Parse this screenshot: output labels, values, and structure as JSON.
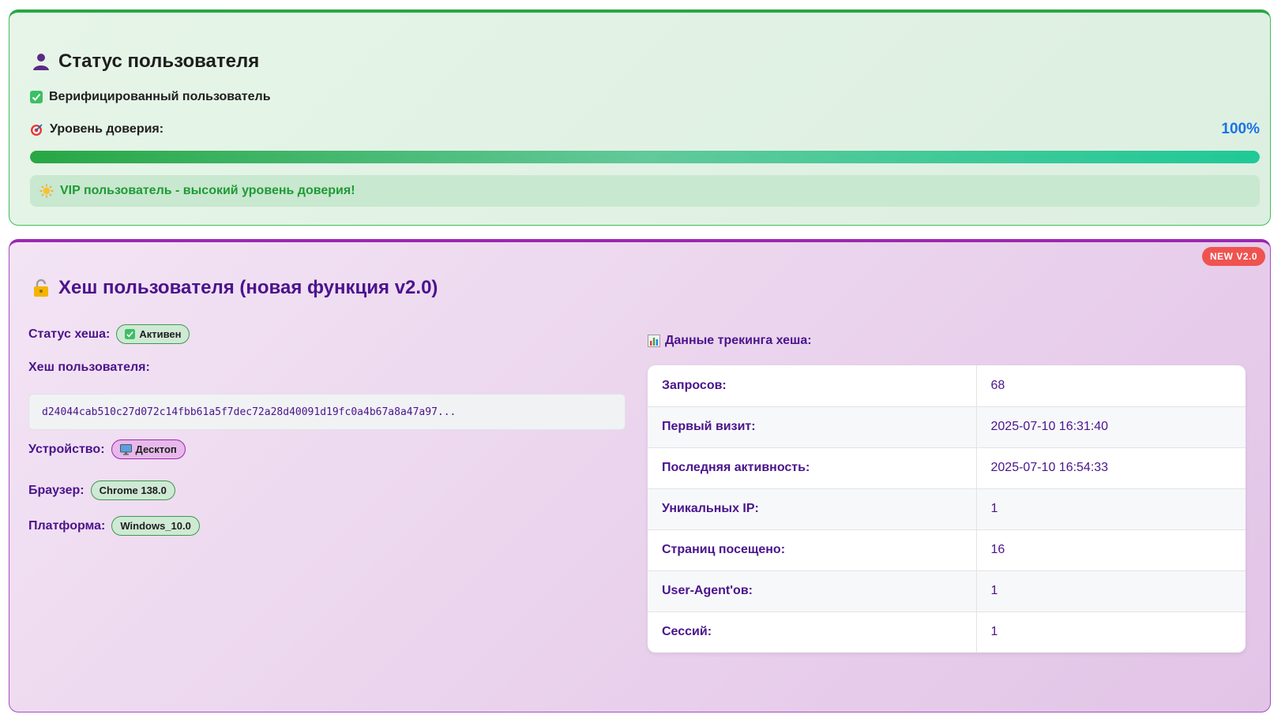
{
  "status": {
    "title": "Статус пользователя",
    "verified_label": "Верифицированный пользователь",
    "trust_label": "Уровень доверия:",
    "trust_value": "100%",
    "trust_fraction": 1.0,
    "vip_text": "VIP пользователь - высокий уровень доверия!",
    "icons": {
      "title": "user-icon",
      "verified": "check-icon",
      "trust": "target-icon",
      "vip": "sun-icon"
    },
    "colors": {
      "accent": "#28a745",
      "trust_value": "#1a73e8",
      "vip_text": "#1f9a36"
    }
  },
  "hash": {
    "badge": "NEW V2.0",
    "title": "Хеш пользователя (новая функция v2.0)",
    "status_label": "Статус хеша:",
    "status_value": "Активен",
    "hash_label": "Хеш пользователя:",
    "hash_value": "d24044cab510c27d072c14fbb61a5f7dec72a28d40091d19fc0a4b67a8a47a97...",
    "device_label": "Устройство:",
    "device_value": "Десктоп",
    "browser_label": "Браузер:",
    "browser_value": "Chrome 138.0",
    "platform_label": "Платформа:",
    "platform_value": "Windows_10.0",
    "tracking_title": "Данные трекинга хеша:",
    "tracking_rows": [
      {
        "key": "Запросов:",
        "value": "68"
      },
      {
        "key": "Первый визит:",
        "value": "2025-07-10 16:31:40"
      },
      {
        "key": "Последняя активность:",
        "value": "2025-07-10 16:54:33"
      },
      {
        "key": "Уникальных IP:",
        "value": "1"
      },
      {
        "key": "Страниц посещено:",
        "value": "16"
      },
      {
        "key": "User-Agent'ов:",
        "value": "1"
      },
      {
        "key": "Сессий:",
        "value": "1"
      }
    ],
    "icons": {
      "title": "lock-icon",
      "status": "check-icon",
      "device": "monitor-icon",
      "tracking": "bar-chart-icon"
    },
    "colors": {
      "accent": "#9c27b0",
      "text": "#4a148c",
      "badge": "#ef5350"
    }
  }
}
